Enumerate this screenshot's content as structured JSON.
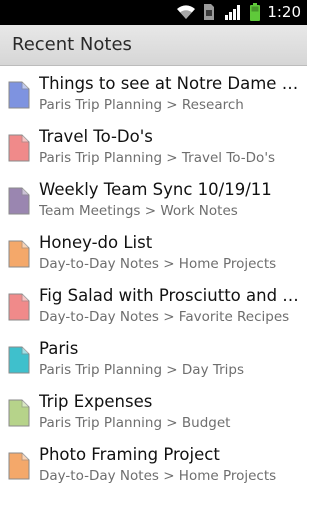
{
  "status_bar": {
    "time": "1:20",
    "icons": [
      "wifi-icon",
      "sim-card-icon",
      "signal-icon",
      "battery-icon"
    ]
  },
  "header": {
    "title": "Recent Notes"
  },
  "notes": [
    {
      "title": "Things to see at Notre Dame Cat...",
      "path": "Paris Trip Planning > Research",
      "color": "#7e93e0"
    },
    {
      "title": "Travel To-Do's",
      "path": "Paris Trip Planning > Travel To-Do's",
      "color": "#f08a8a"
    },
    {
      "title": "Weekly Team Sync 10/19/11",
      "path": "Team Meetings > Work Notes",
      "color": "#9a86b0"
    },
    {
      "title": "Honey-do List",
      "path": "Day-to-Day Notes > Home Projects",
      "color": "#f4a86a"
    },
    {
      "title": "Fig Salad with Prosciutto and Wa...",
      "path": "Day-to-Day Notes > Favorite Recipes",
      "color": "#f08a8a"
    },
    {
      "title": "Paris",
      "path": "Paris Trip Planning > Day Trips",
      "color": "#3fc0cc"
    },
    {
      "title": "Trip Expenses",
      "path": "Paris Trip Planning > Budget",
      "color": "#b6d38a"
    },
    {
      "title": "Photo Framing Project",
      "path": "Day-to-Day Notes > Home Projects",
      "color": "#f4a86a"
    }
  ]
}
